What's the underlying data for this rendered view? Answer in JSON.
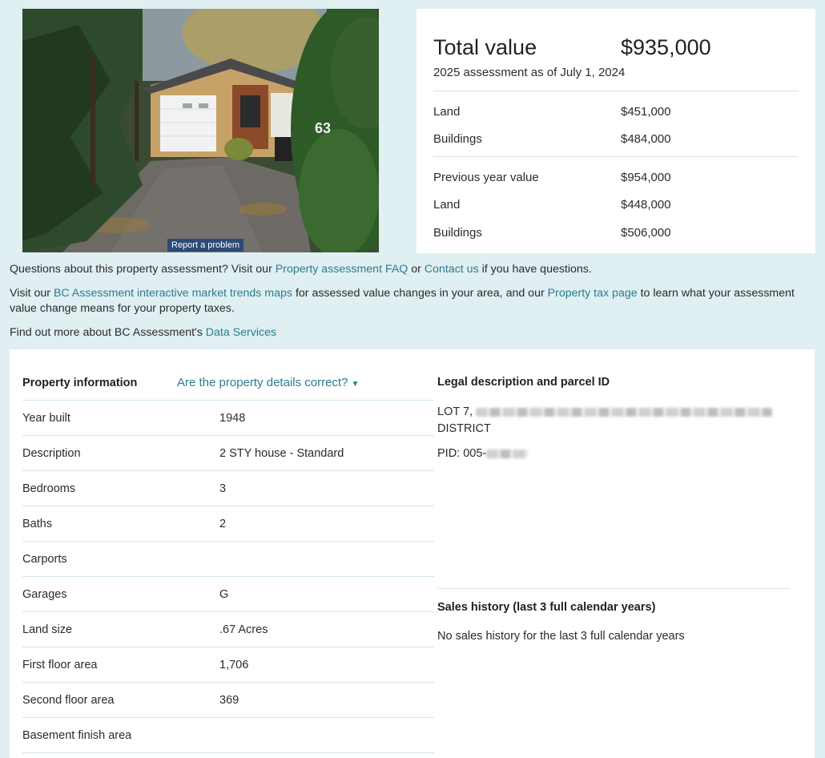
{
  "photo": {
    "alt": "Property photo",
    "report_label": "Report a problem",
    "house_number_partial": "63"
  },
  "valuation": {
    "total_label": "Total value",
    "total_value": "$935,000",
    "subtitle": "2025 assessment as of July 1, 2024",
    "current": [
      {
        "label": "Land",
        "value": "$451,000"
      },
      {
        "label": "Buildings",
        "value": "$484,000"
      }
    ],
    "previous": [
      {
        "label": "Previous year value",
        "value": "$954,000"
      },
      {
        "label": "Land",
        "value": "$448,000"
      },
      {
        "label": "Buildings",
        "value": "$506,000"
      }
    ]
  },
  "info": {
    "p1_a": "Questions about this property assessment? Visit our ",
    "p1_link1": "Property assessment FAQ",
    "p1_b": " or ",
    "p1_link2": "Contact us",
    "p1_c": " if you have questions.",
    "p2_a": "Visit our ",
    "p2_link1": "BC Assessment interactive market trends maps",
    "p2_b": " for assessed value changes in your area, and our ",
    "p2_link2": "Property tax page",
    "p2_c": " to learn what your assessment value change means for your property taxes.",
    "p3_a": "Find out more about BC Assessment's ",
    "p3_link": "Data Services"
  },
  "property_info": {
    "title": "Property information",
    "toggle_label": "Are the property details correct?",
    "rows": [
      {
        "label": "Year built",
        "value": "1948"
      },
      {
        "label": "Description",
        "value": "2 STY house - Standard"
      },
      {
        "label": "Bedrooms",
        "value": "3"
      },
      {
        "label": "Baths",
        "value": "2"
      },
      {
        "label": "Carports",
        "value": ""
      },
      {
        "label": "Garages",
        "value": "G"
      },
      {
        "label": "Land size",
        "value": ".67 Acres"
      },
      {
        "label": "First floor area",
        "value": "1,706"
      },
      {
        "label": "Second floor area",
        "value": "369"
      },
      {
        "label": "Basement finish area",
        "value": ""
      }
    ]
  },
  "legal": {
    "title": "Legal description and parcel ID",
    "lot_prefix": "LOT 7,",
    "district": "DISTRICT",
    "pid_prefix": "PID: 005-"
  },
  "sales": {
    "title": "Sales history (last 3 full calendar years)",
    "text": "No sales history for the last 3 full calendar years"
  }
}
